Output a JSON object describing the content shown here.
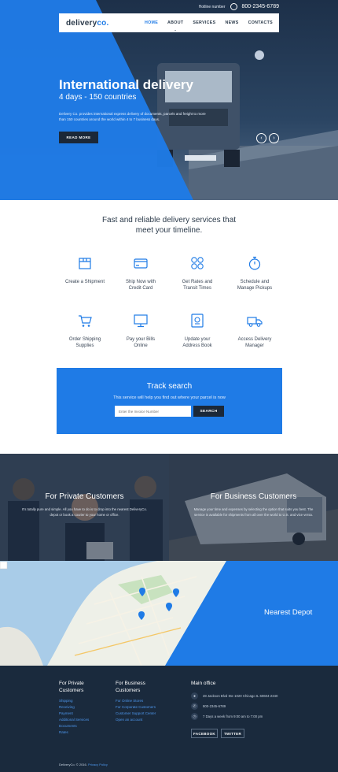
{
  "brand": {
    "logo_main": "delivery",
    "logo_accent": "co."
  },
  "topbar": {
    "hotline_label": "Hotline number",
    "phone": "800-2345-6789"
  },
  "nav": {
    "items": [
      "HOME",
      "ABOUT",
      "SERVICES",
      "NEWS",
      "CONTACTS"
    ],
    "active": "HOME"
  },
  "hero": {
    "title": "International delivery",
    "subtitle": "4 days - 150 countries",
    "text": "Delivery Co. provides international express delivery of documents, parcels and freight to more than 150 countries around the world within 4 to 7 business days.",
    "button": "READ MORE"
  },
  "services": {
    "heading_line1": "Fast and reliable delivery services that",
    "heading_line2": "meet your timeline.",
    "items": [
      {
        "l1": "Create a Shipment",
        "l2": "",
        "icon": "box-icon"
      },
      {
        "l1": "Ship Now with",
        "l2": "Credit Card",
        "icon": "credit-card-icon"
      },
      {
        "l1": "Get Rates and",
        "l2": "Transit Times",
        "icon": "calculator-icon"
      },
      {
        "l1": "Schedule and",
        "l2": "Manage Pickups",
        "icon": "stopwatch-icon"
      },
      {
        "l1": "Order Shipping",
        "l2": "Supplies",
        "icon": "shopping-cart-icon"
      },
      {
        "l1": "Pay your Bills",
        "l2": "Online",
        "icon": "monitor-icon"
      },
      {
        "l1": "Update your",
        "l2": "Address Book",
        "icon": "address-book-icon"
      },
      {
        "l1": "Access Delivery",
        "l2": "Manager",
        "icon": "delivery-truck-icon"
      }
    ]
  },
  "track": {
    "title": "Track search",
    "subtitle": "This service will help you find out where your parcel is now",
    "placeholder": "Enter the Invoice Number",
    "button": "SEARCH"
  },
  "customers": {
    "private": {
      "title": "For Private Customers",
      "text": "It's totally pure and simple. All you have to do is to drop into the nearest DeliveryCo. depot or book a courier to your home or office."
    },
    "business": {
      "title": "For Business Customers",
      "text": "Manage your time and expenses by selecting the option that suits you best. The service is available for shipments from all over the world to U.S. and vice versa."
    }
  },
  "map": {
    "title": "Nearest Depot"
  },
  "footer": {
    "col1": {
      "title1": "For Private",
      "title2": "Customers",
      "links": [
        "Shipping",
        "Receiving",
        "Payment",
        "Additional Services",
        "Documents",
        "Rates"
      ]
    },
    "col2": {
      "title1": "For Business",
      "title2": "Customers",
      "links": [
        "For Online Stores",
        "For Corporate Customers",
        "Customer Support Center",
        "Open an account"
      ]
    },
    "office": {
      "title": "Main office",
      "address": "28 Jackson Blvd Ste 1020 Chicago IL 60604-2340",
      "phone": "800-2345-6789",
      "hours": "7 Days a week from 9:00 am to 7:00 pm"
    },
    "social": [
      "FACEBOOK",
      "TWITTER"
    ],
    "copyright": "DeliveryCo. © 2016.",
    "privacy": "Privacy Policy"
  },
  "colors": {
    "accent": "#1f7be6",
    "dark": "#1a2a3d",
    "text": "#2b3a4a"
  }
}
